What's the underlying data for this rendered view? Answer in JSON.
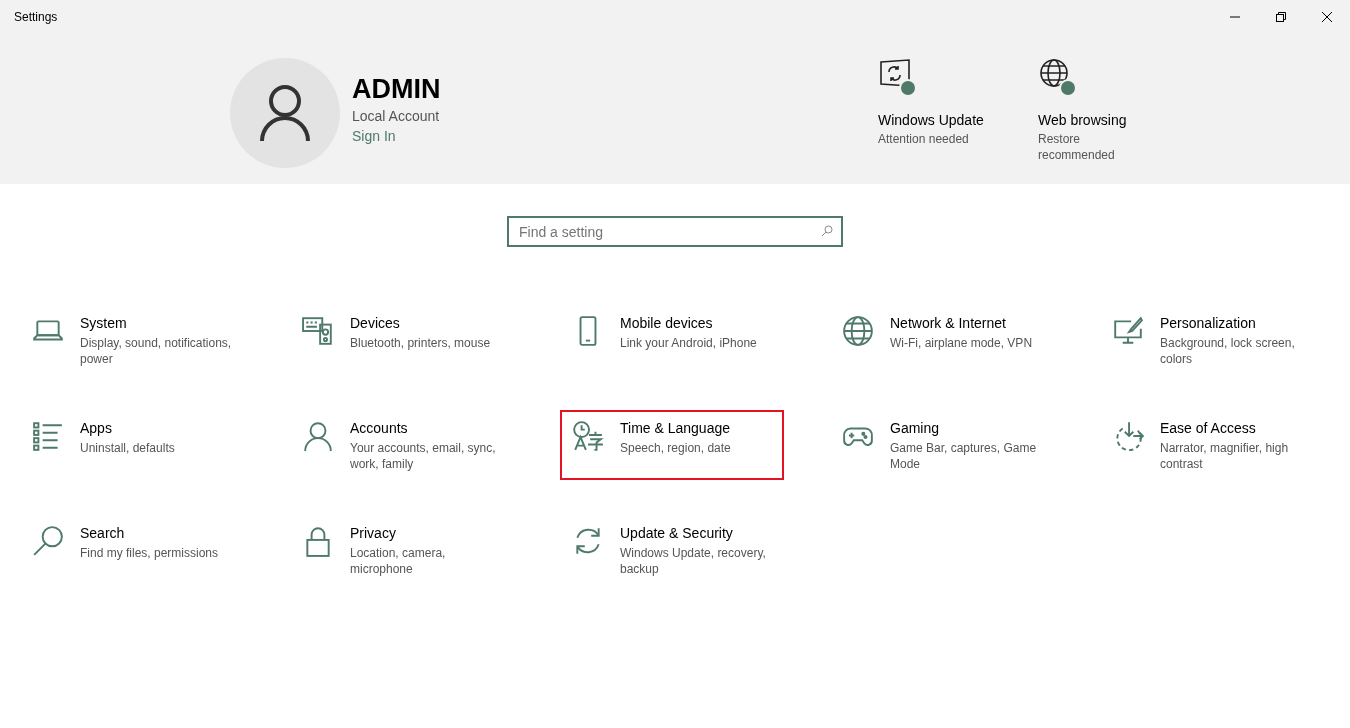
{
  "window": {
    "title": "Settings"
  },
  "account": {
    "name": "ADMIN",
    "type": "Local Account",
    "link": "Sign In"
  },
  "status_items": [
    {
      "title": "Windows Update",
      "subtitle": "Attention needed"
    },
    {
      "title": "Web browsing",
      "subtitle": "Restore recommended"
    }
  ],
  "search": {
    "placeholder": "Find a setting"
  },
  "categories": [
    {
      "title": "System",
      "subtitle": "Display, sound, notifications, power",
      "highlighted": false
    },
    {
      "title": "Devices",
      "subtitle": "Bluetooth, printers, mouse",
      "highlighted": false
    },
    {
      "title": "Mobile devices",
      "subtitle": "Link your Android, iPhone",
      "highlighted": false
    },
    {
      "title": "Network & Internet",
      "subtitle": "Wi-Fi, airplane mode, VPN",
      "highlighted": false
    },
    {
      "title": "Personalization",
      "subtitle": "Background, lock screen, colors",
      "highlighted": false
    },
    {
      "title": "Apps",
      "subtitle": "Uninstall, defaults",
      "highlighted": false
    },
    {
      "title": "Accounts",
      "subtitle": "Your accounts, email, sync, work, family",
      "highlighted": false
    },
    {
      "title": "Time & Language",
      "subtitle": "Speech, region, date",
      "highlighted": true
    },
    {
      "title": "Gaming",
      "subtitle": "Game Bar, captures, Game Mode",
      "highlighted": false
    },
    {
      "title": "Ease of Access",
      "subtitle": "Narrator, magnifier, high contrast",
      "highlighted": false
    },
    {
      "title": "Search",
      "subtitle": "Find my files, permissions",
      "highlighted": false
    },
    {
      "title": "Privacy",
      "subtitle": "Location, camera, microphone",
      "highlighted": false
    },
    {
      "title": "Update & Security",
      "subtitle": "Windows Update, recovery, backup",
      "highlighted": false
    }
  ]
}
